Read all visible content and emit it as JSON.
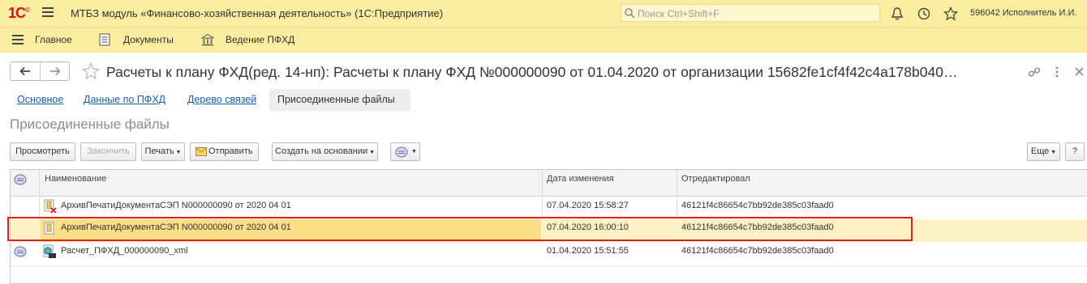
{
  "app": {
    "logo": "1С",
    "title": "МТБЗ модуль «Финансово-хозяйственная деятельность»  (1С:Предприятие)",
    "search_placeholder": "Поиск Ctrl+Shift+F",
    "user": "596042 Исполнитель И.И."
  },
  "sections": [
    {
      "label": "Главное",
      "icon": "menu-icon"
    },
    {
      "label": "Документы",
      "icon": "document-icon"
    },
    {
      "label": "Ведение ПФХД",
      "icon": "bank-icon"
    }
  ],
  "form": {
    "title": "Расчеты к плану ФХД(ред. 14-нп): Расчеты к плану ФХД №000000090 от 01.04.2020 от организации 15682fe1cf4f42c4a178b040…",
    "tabs": [
      "Основное",
      "Данные по ПФХД",
      "Дерево связей",
      "Присоединенные файлы"
    ],
    "active_tab": "Присоединенные файлы",
    "subtitle": "Присоединенные файлы"
  },
  "toolbar": {
    "view": "Просмотреть",
    "finish": "Закончить",
    "print": "Печать",
    "send": "Отправить",
    "create_based": "Создать на основании",
    "more": "Еще",
    "help": "?"
  },
  "table": {
    "columns": [
      "Наименование",
      "Дата изменения",
      "Отредактировал"
    ],
    "rows": [
      {
        "name": "АрхивПечатиДокументаСЭП N000000090 от 2020 04 01",
        "date": "07.04.2020 15:58:27",
        "editor": "46121f4c86654c7bb92de385c03faad0",
        "icon": "archive-deleted-icon",
        "selected": false
      },
      {
        "name": "АрхивПечатиДокументаСЭП N000000090 от 2020 04 01",
        "date": "07.04.2020 16:00:10",
        "editor": "46121f4c86654c7bb92de385c03faad0",
        "icon": "archive-icon",
        "selected": true
      },
      {
        "name": "Расчет_ПФХД_000000090_xml",
        "date": "01.04.2020 15:51:55",
        "editor": "46121f4c86654c7bb92de385c03faad0",
        "icon": "xml-file-icon",
        "selected": false
      }
    ]
  },
  "colors": {
    "header_bg": "#fbeda0",
    "link": "#1a5fa8",
    "selected_row": "#fdf1c4",
    "selected_cell": "#fadf88",
    "highlight_border": "#e02020"
  }
}
